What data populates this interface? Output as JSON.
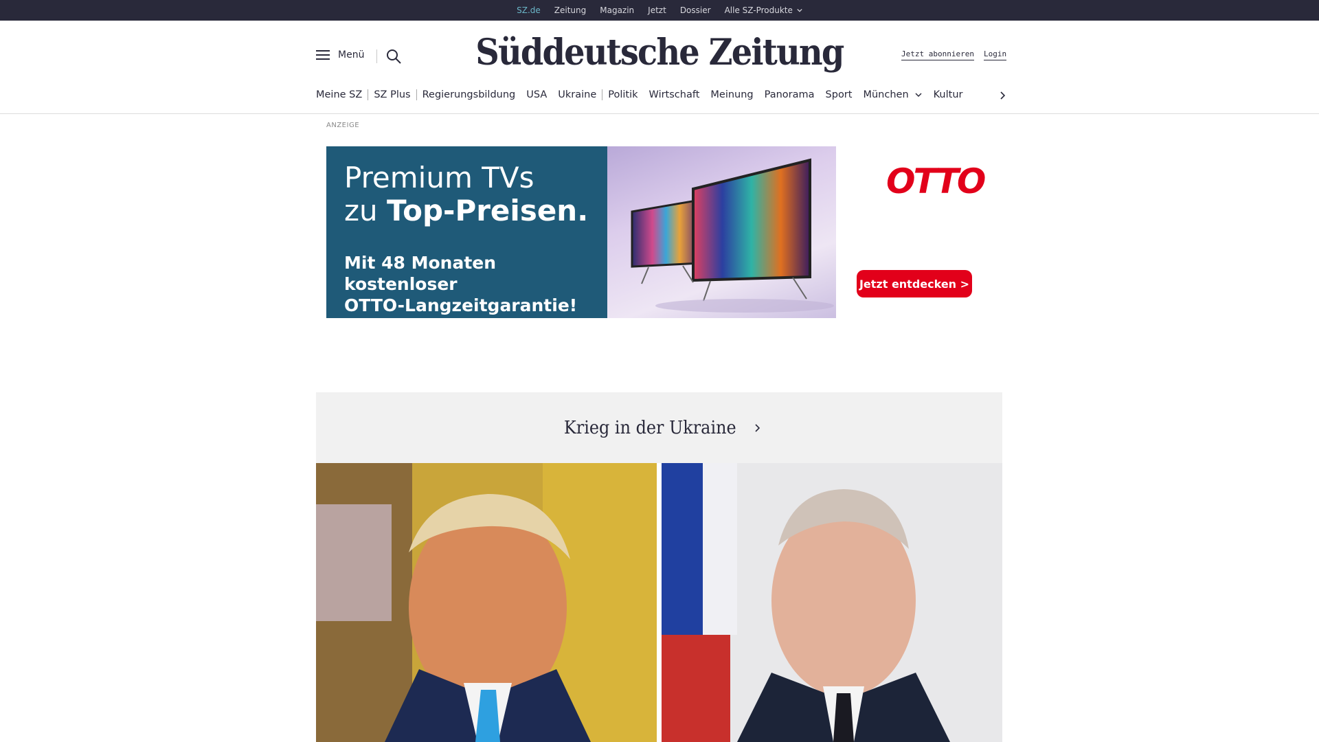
{
  "topbar": {
    "items": [
      {
        "label": "SZ.de",
        "active": true
      },
      {
        "label": "Zeitung",
        "active": false
      },
      {
        "label": "Magazin",
        "active": false
      },
      {
        "label": "Jetzt",
        "active": false
      },
      {
        "label": "Dossier",
        "active": false
      },
      {
        "label": "Alle SZ-Produkte",
        "active": false
      }
    ]
  },
  "header": {
    "menu_label": "Menü",
    "logo": "Süddeutsche Zeitung",
    "subscribe_label": "Jetzt abonnieren",
    "login_label": "Login"
  },
  "nav": {
    "items": [
      "Meine SZ",
      "SZ Plus",
      "Regierungsbildung",
      "USA",
      "Ukraine",
      "Politik",
      "Wirtschaft",
      "Meinung",
      "Panorama",
      "Sport",
      "München",
      "Kultur"
    ]
  },
  "ad": {
    "label": "ANZEIGE",
    "headline_line1": "Premium TVs",
    "headline_line2_prefix": "zu ",
    "headline_line2_bold": "Top-Preisen.",
    "subline_line1": "Mit 48 Monaten kostenloser",
    "subline_line2": "OTTO-Langzeitgarantie!",
    "brand": "OTTO",
    "cta": "Jetzt entdecken >"
  },
  "section": {
    "title": "Krieg in der Ukraine"
  },
  "colors": {
    "topbar_bg": "#29293a",
    "topbar_active": "#6bb6c8",
    "ad_panel": "#1f5a78",
    "otto_red": "#e2001a",
    "section_bg": "#f1f1f1"
  }
}
